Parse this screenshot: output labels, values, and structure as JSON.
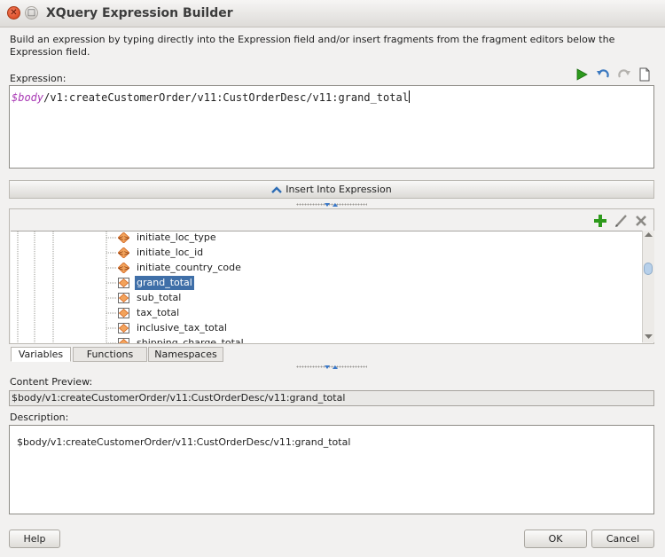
{
  "window": {
    "title": "XQuery Expression Builder",
    "close_glyph": "✕",
    "max_glyph": "□"
  },
  "intro_text": "Build an expression by typing directly into the Expression field and/or insert fragments from the fragment editors below the Expression field.",
  "expression": {
    "label": "Expression:",
    "variable": "$body",
    "rest": "/v1:createCustomerOrder/v11:CustOrderDesc/v11:grand_total",
    "toolbar_icons": [
      "run-icon",
      "undo-icon",
      "redo-icon",
      "clear-icon"
    ]
  },
  "insert_button": {
    "label": "Insert Into Expression"
  },
  "fragment_toolbar_icons": [
    "add-icon",
    "edit-icon",
    "delete-icon"
  ],
  "tree": {
    "items": [
      {
        "label": "initiate_loc_type",
        "type": "element"
      },
      {
        "label": "initiate_loc_id",
        "type": "element"
      },
      {
        "label": "initiate_country_code",
        "type": "element"
      },
      {
        "label": "grand_total",
        "type": "element",
        "selected": true
      },
      {
        "label": "sub_total",
        "type": "element"
      },
      {
        "label": "tax_total",
        "type": "element"
      },
      {
        "label": "inclusive_tax_total",
        "type": "element"
      },
      {
        "label": "shipping_charge_total",
        "type": "element"
      }
    ]
  },
  "tabs": [
    {
      "label": "Variables",
      "active": true
    },
    {
      "label": "Functions",
      "active": false
    },
    {
      "label": "Namespaces",
      "active": false
    }
  ],
  "content_preview": {
    "label": "Content Preview:",
    "value": "$body/v1:createCustomerOrder/v11:CustOrderDesc/v11:grand_total"
  },
  "description": {
    "label": "Description:",
    "value": "$body/v1:createCustomerOrder/v11:CustOrderDesc/v11:grand_total"
  },
  "buttons": {
    "help": "Help",
    "ok": "OK",
    "cancel": "Cancel"
  },
  "colors": {
    "selection": "#3f6fa8",
    "variable": "#a93ab5",
    "run_green": "#2d9a1d",
    "element_orange": "#e36b1c"
  }
}
